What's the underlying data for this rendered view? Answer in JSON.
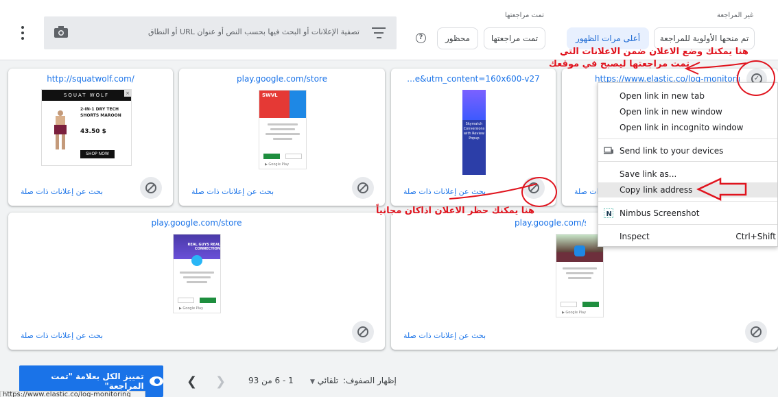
{
  "header": {
    "search_placeholder": "تصفية الإعلانات أو البحث فيها بحسب النص أو عنوان URL أو النطاق",
    "group_unreviewed_label": "غير المراجعة",
    "group_reviewed_label": "تمت مراجعتها",
    "chips": {
      "priority": "تم منحها الأولوية للمراجعة",
      "most_impressions": "أعلى مرات الظهور",
      "reviewed": "تمت مراجعتها",
      "blocked": "محظور"
    }
  },
  "cards": [
    {
      "url": "http://squatwolf.com/",
      "related": "بحث عن إعلانات ذات صلة"
    },
    {
      "url": "play.google.com/store",
      "related": "بحث عن إعلانات ذات صلة"
    },
    {
      "url": "...e&utm_content=160x600-v27",
      "related": "بحث عن إعلانات ذات صلة"
    },
    {
      "url": "https://www.elastic.co/log-monitoring",
      "related": "بحث عن إعلانات ذات صلة"
    },
    {
      "url": "play.google.com/store",
      "related": "بحث عن إعلانات ذات صلة"
    },
    {
      "url": "play.google.com/store",
      "related": "بحث عن إعلانات ذات صلة"
    }
  ],
  "ads": {
    "squat": {
      "brand": "SQUAT WOLF",
      "product": "2-IN-1 DRY TECH SHORTS MAROON",
      "price": "43.50 $",
      "cta": "SHOP NOW"
    },
    "play1": {
      "brand": "SWVL"
    },
    "elastic": {
      "title": "Skymatch Conversions with Review Popup"
    },
    "play2": {
      "title": "REAL GUYS REAL CONNECTION"
    }
  },
  "context_menu": {
    "items": [
      "Open link in new tab",
      "Open link in new window",
      "Open link in incognito window",
      "Send link to your devices",
      "Save link as...",
      "Copy link address",
      "Nimbus Screenshot",
      "Inspect"
    ],
    "inspect_shortcut": "Ctrl+Shift"
  },
  "annotations": {
    "top_line1": "هنا يمكنك وضع الاعلان ضمن الاعلانات التي",
    "top_line2": "تمت مراجعتها ليصبح في موقعك",
    "bottom": "هنا يمكنك حظر الاعلان اذاكان مجانياً"
  },
  "footer": {
    "mark_all": "تمييز الكل بعلامة \"تمت المراجعة\"",
    "rows_label": "إظهار الصفوف:",
    "rows_value": "تلقائي",
    "range": "1 - 6 من 93",
    "status_url": "https://www.elastic.co/log-monitoring"
  },
  "colors": {
    "accent": "#1a73e8",
    "annotation": "#e0141e"
  }
}
